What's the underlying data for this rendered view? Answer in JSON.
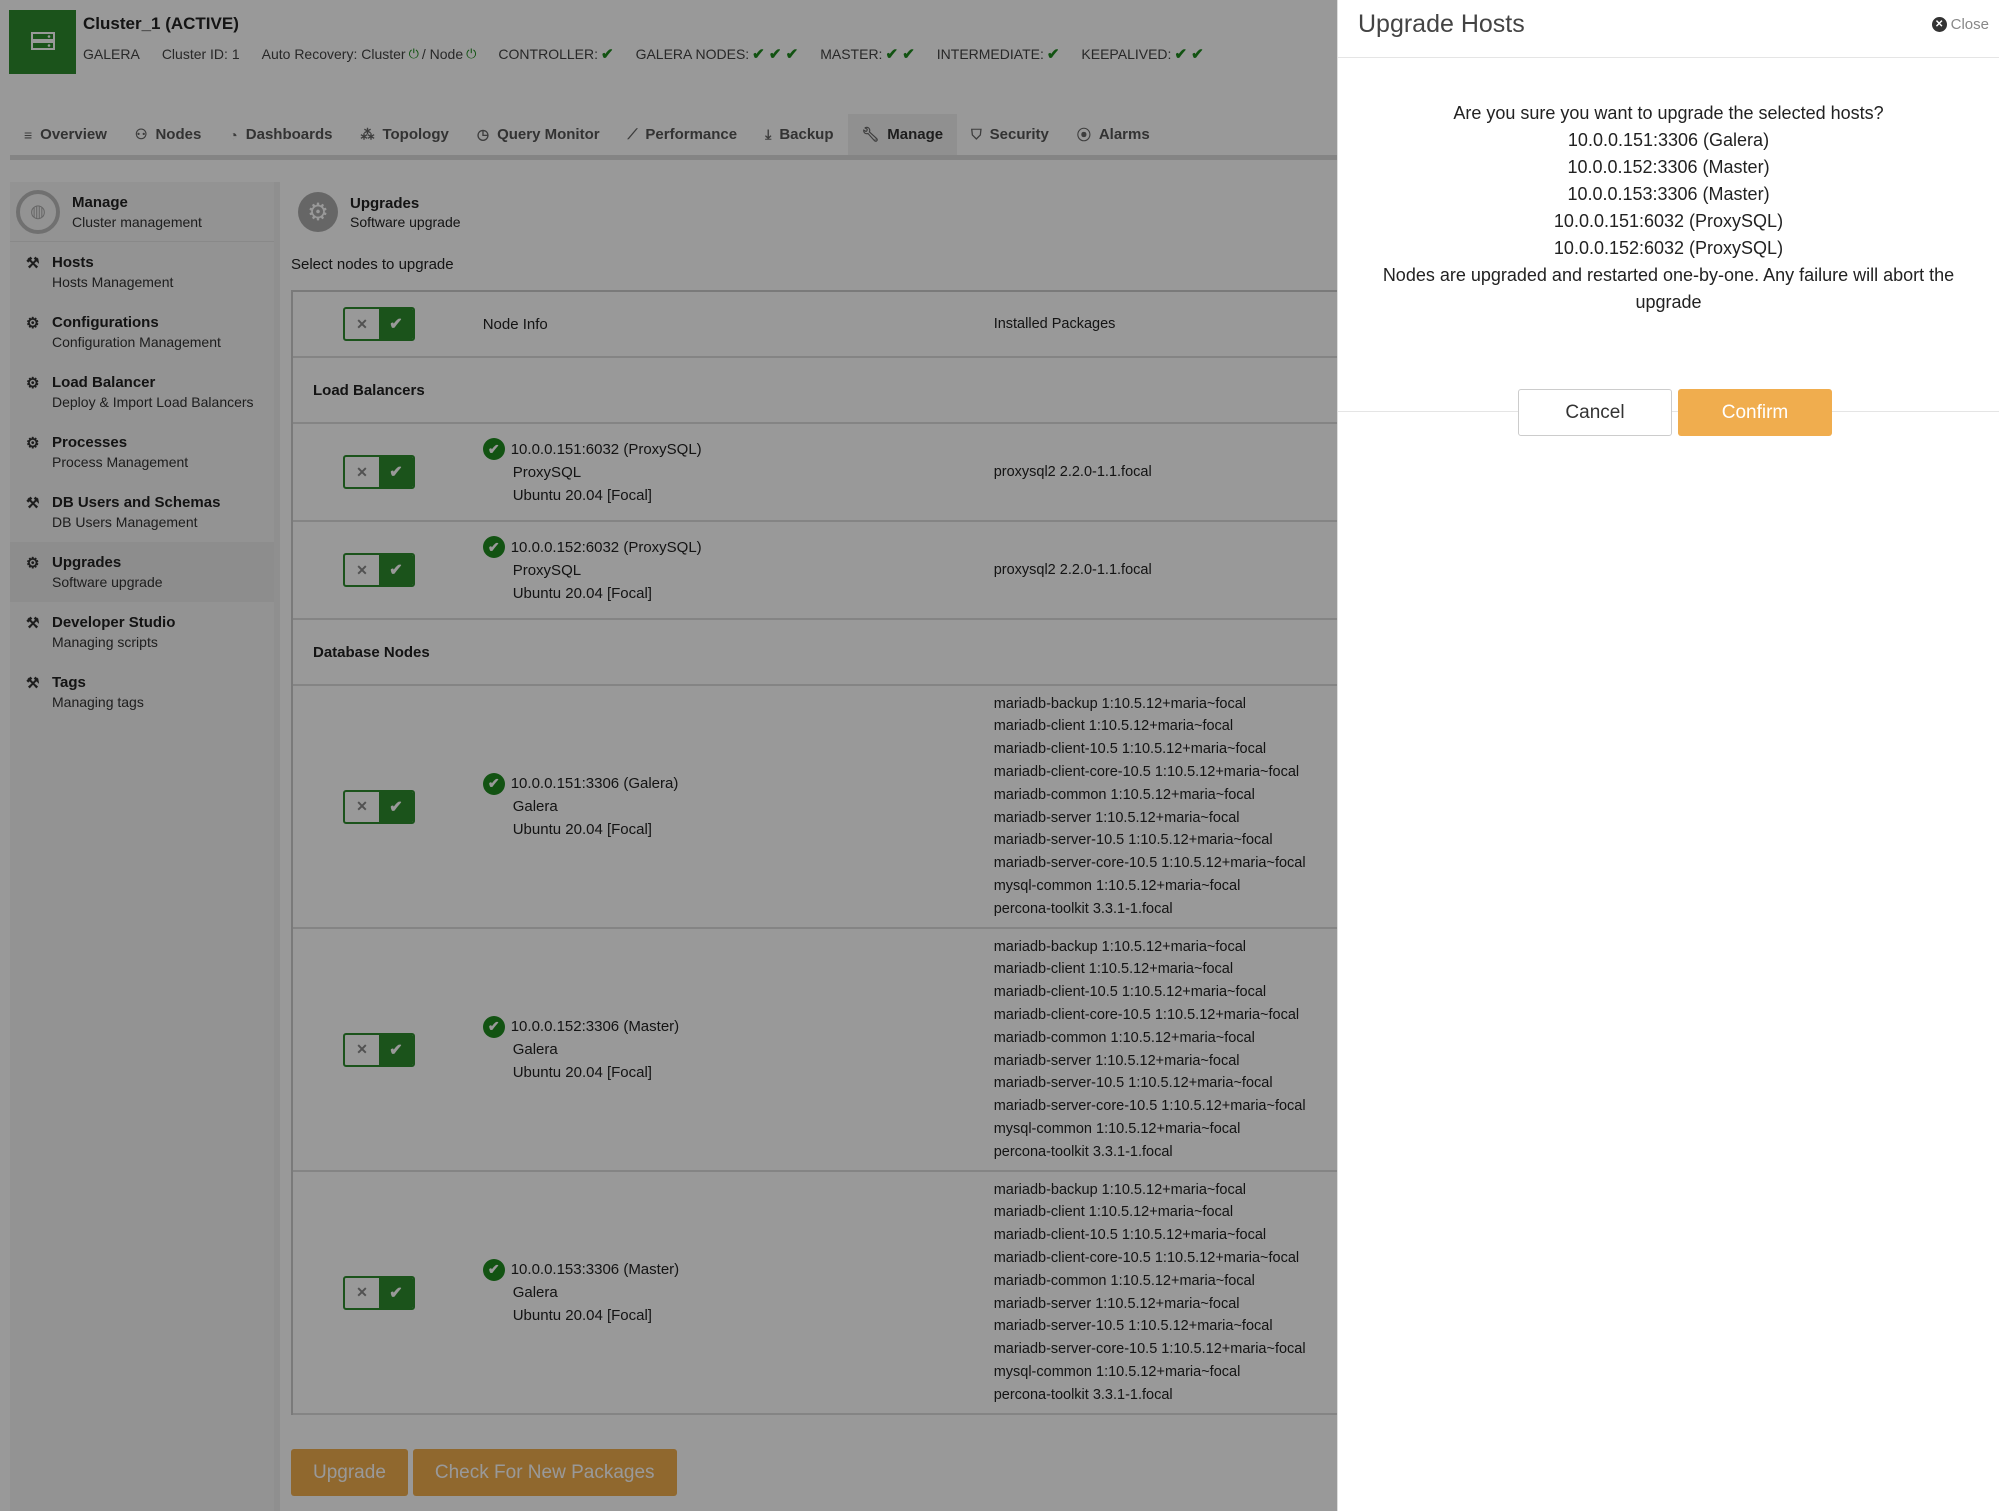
{
  "cluster": {
    "title": "Cluster_1 (ACTIVE)",
    "type": "GALERA",
    "cluster_id": "Cluster ID: 1",
    "auto_recovery": "Auto Recovery: Cluster",
    "auto_recovery_node": "/ Node",
    "controller": "CONTROLLER:",
    "galera_nodes": "GALERA NODES:",
    "master": "MASTER:",
    "intermediate": "INTERMEDIATE:",
    "keepalived": "KEEPALIVED:"
  },
  "tabs": [
    {
      "label": "Overview",
      "icon": "list-icon"
    },
    {
      "label": "Nodes",
      "icon": "nodes-icon"
    },
    {
      "label": "Dashboards",
      "icon": "dashboard-icon"
    },
    {
      "label": "Topology",
      "icon": "topology-icon"
    },
    {
      "label": "Query Monitor",
      "icon": "clock-icon"
    },
    {
      "label": "Performance",
      "icon": "chart-icon"
    },
    {
      "label": "Backup",
      "icon": "download-icon"
    },
    {
      "label": "Manage",
      "icon": "wrench-icon"
    },
    {
      "label": "Security",
      "icon": "shield-icon"
    },
    {
      "label": "Alarms",
      "icon": "signal-icon"
    }
  ],
  "sidebar": {
    "title": "Manage",
    "subtitle": "Cluster management",
    "items": [
      {
        "label": "Hosts",
        "sub": "Hosts Management",
        "icon": "wrench-icon"
      },
      {
        "label": "Configurations",
        "sub": "Configuration Management",
        "icon": "gear-icon"
      },
      {
        "label": "Load Balancer",
        "sub": "Deploy & Import Load Balancers",
        "icon": "gear-icon"
      },
      {
        "label": "Processes",
        "sub": "Process Management",
        "icon": "gear-icon"
      },
      {
        "label": "DB Users and Schemas",
        "sub": "DB Users Management",
        "icon": "wrench-icon"
      },
      {
        "label": "Upgrades",
        "sub": "Software upgrade",
        "icon": "gear-icon"
      },
      {
        "label": "Developer Studio",
        "sub": "Managing scripts",
        "icon": "hammer-icon"
      },
      {
        "label": "Tags",
        "sub": "Managing tags",
        "icon": "hammer-icon"
      }
    ]
  },
  "content": {
    "title": "Upgrades",
    "subtitle": "Software upgrade",
    "select_label": "Select nodes to upgrade",
    "col_node_info": "Node Info",
    "col_packages": "Installed Packages",
    "section_lb": "Load Balancers",
    "section_db": "Database Nodes",
    "lb_rows": [
      {
        "host": "10.0.0.151:6032 (ProxySQL)",
        "role": "ProxySQL",
        "os": "Ubuntu 20.04 [Focal]",
        "packages": [
          "proxysql2 2.2.0-1.1.focal"
        ]
      },
      {
        "host": "10.0.0.152:6032 (ProxySQL)",
        "role": "ProxySQL",
        "os": "Ubuntu 20.04 [Focal]",
        "packages": [
          "proxysql2 2.2.0-1.1.focal"
        ]
      }
    ],
    "db_rows": [
      {
        "host": "10.0.0.151:3306 (Galera)",
        "role": "Galera",
        "os": "Ubuntu 20.04 [Focal]"
      },
      {
        "host": "10.0.0.152:3306 (Master)",
        "role": "Galera",
        "os": "Ubuntu 20.04 [Focal]"
      },
      {
        "host": "10.0.0.153:3306 (Master)",
        "role": "Galera",
        "os": "Ubuntu 20.04 [Focal]"
      }
    ],
    "db_packages": [
      "mariadb-backup 1:10.5.12+maria~focal",
      "mariadb-client 1:10.5.12+maria~focal",
      "mariadb-client-10.5 1:10.5.12+maria~focal",
      "mariadb-client-core-10.5 1:10.5.12+maria~focal",
      "mariadb-common 1:10.5.12+maria~focal",
      "mariadb-server 1:10.5.12+maria~focal",
      "mariadb-server-10.5 1:10.5.12+maria~focal",
      "mariadb-server-core-10.5 1:10.5.12+maria~focal",
      "mysql-common 1:10.5.12+maria~focal",
      "percona-toolkit 3.3.1-1.focal"
    ],
    "upgrade_button": "Upgrade",
    "check_button": "Check For New Packages"
  },
  "dialog": {
    "title": "Upgrade Hosts",
    "close": "Close",
    "question": "Are you sure you want to upgrade the selected hosts?",
    "hosts": [
      "10.0.0.151:3306 (Galera)",
      "10.0.0.152:3306 (Master)",
      "10.0.0.153:3306 (Master)",
      "10.0.0.151:6032 (ProxySQL)",
      "10.0.0.152:6032 (ProxySQL)"
    ],
    "note": "Nodes are upgraded and restarted one-by-one. Any failure will abort the upgrade",
    "cancel": "Cancel",
    "confirm": "Confirm"
  },
  "colors": {
    "accent_green": "#2e8b2e",
    "button_orange": "#f0ad4e"
  }
}
